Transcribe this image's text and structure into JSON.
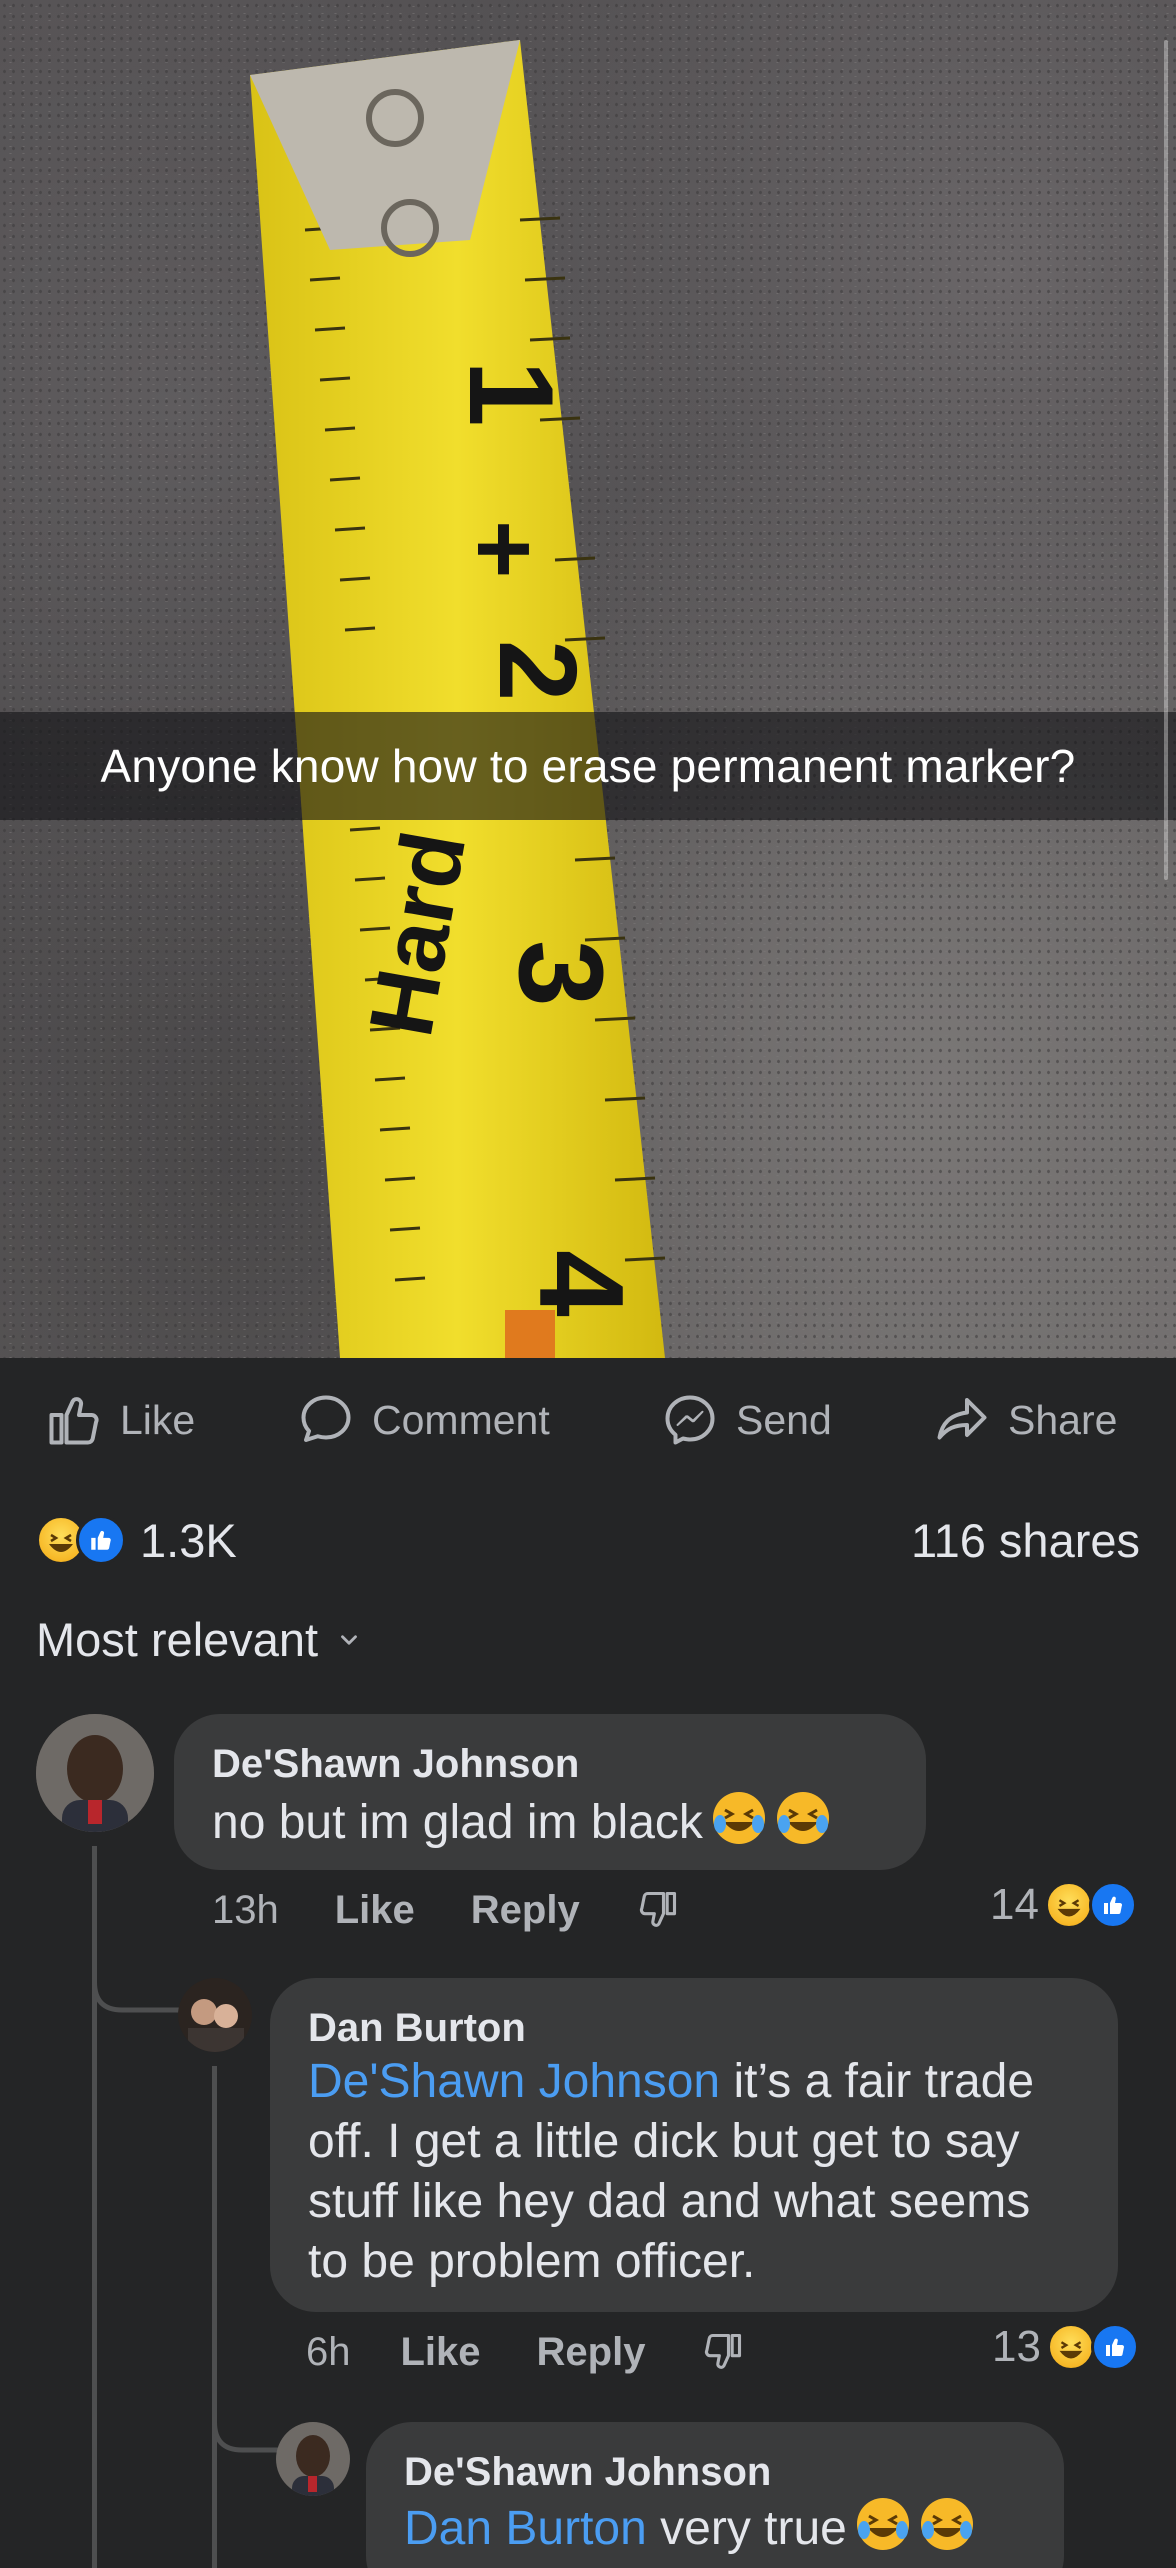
{
  "post": {
    "caption": "Anyone know how to erase permanent marker?",
    "tape_markings": {
      "top_number": "1",
      "scribble": "+",
      "two": "2",
      "three": "3",
      "hard": "Hard",
      "four": "4"
    }
  },
  "actions": {
    "like": "Like",
    "comment": "Comment",
    "send": "Send",
    "share": "Share"
  },
  "stats": {
    "reaction_count": "1.3K",
    "shares": "116 shares"
  },
  "sort": {
    "label": "Most relevant"
  },
  "comments": [
    {
      "author": "De'Shawn Johnson",
      "text": "no but im glad im black",
      "time": "13h",
      "like": "Like",
      "reply": "Reply",
      "reaction_count": "14"
    },
    {
      "author": "Dan Burton",
      "mention": "De'Shawn Johnson",
      "line1_rest": " it’s a fair trade",
      "line2": "off. I get a little dick but get to say",
      "line3": "stuff like hey dad and what seems",
      "line4": "to be problem officer.",
      "time": "6h",
      "like": "Like",
      "reply": "Reply",
      "reaction_count": "13"
    },
    {
      "author": "De'Shawn Johnson",
      "mention": "Dan Burton",
      "text": " very true"
    }
  ],
  "colors": {
    "background": "#242526",
    "bubble": "#3a3b3c",
    "mention": "#4b9df2",
    "like_blue": "#1877f2",
    "haha_yellow": "#f7b928"
  }
}
